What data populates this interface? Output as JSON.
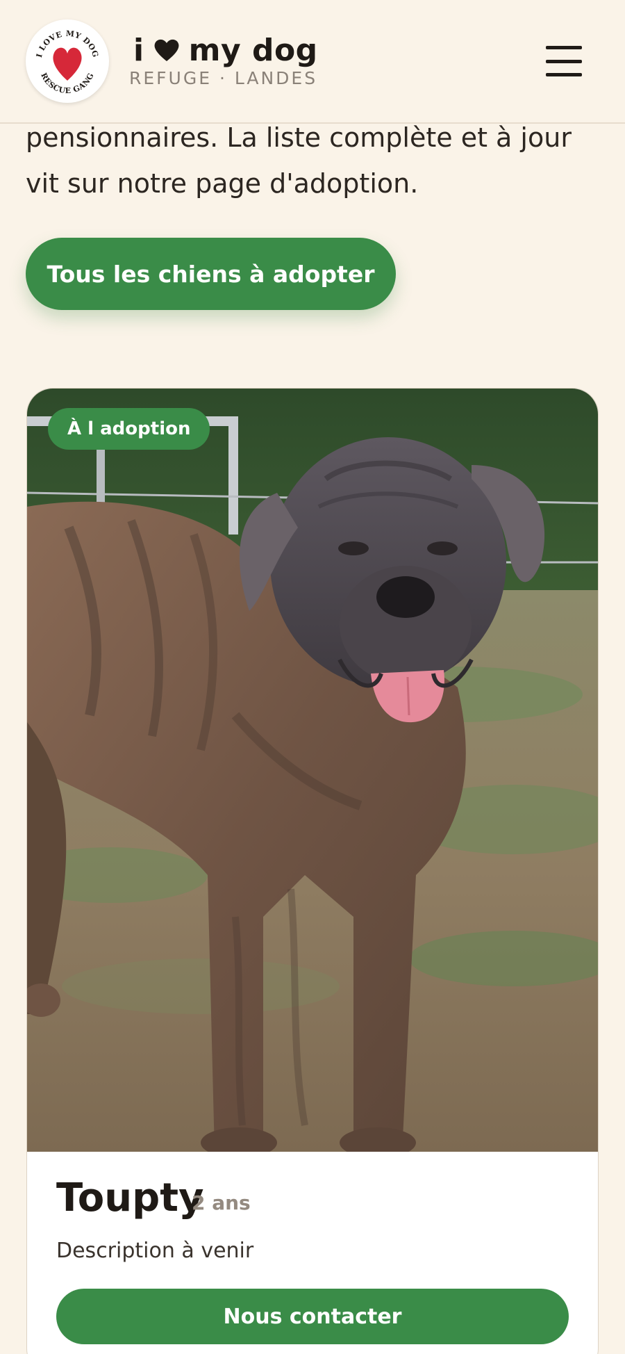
{
  "header": {
    "logo_text_top": "I LOVE MY DOG",
    "logo_text_bottom": "RESCUE GANG",
    "brand_i": "i",
    "brand_rest": "my dog",
    "brand_subtitle": "REFUGE · LANDES"
  },
  "intro": {
    "text": "pensionnaires. La liste complète et à jour vit sur notre page d'adoption."
  },
  "cta": {
    "label": "Tous les chiens à adopter"
  },
  "card": {
    "badge": "À l adoption",
    "name": "Toupty",
    "age": "2 ans",
    "description": "Description à venir",
    "contact_label": "Nous contacter"
  },
  "colors": {
    "background": "#faf3e8",
    "accent_green": "#3a8c48",
    "heart_red": "#d62839",
    "text_dark": "#1f1a16"
  },
  "icons": {
    "menu": "hamburger-icon",
    "brand_heart": "heart-icon"
  }
}
